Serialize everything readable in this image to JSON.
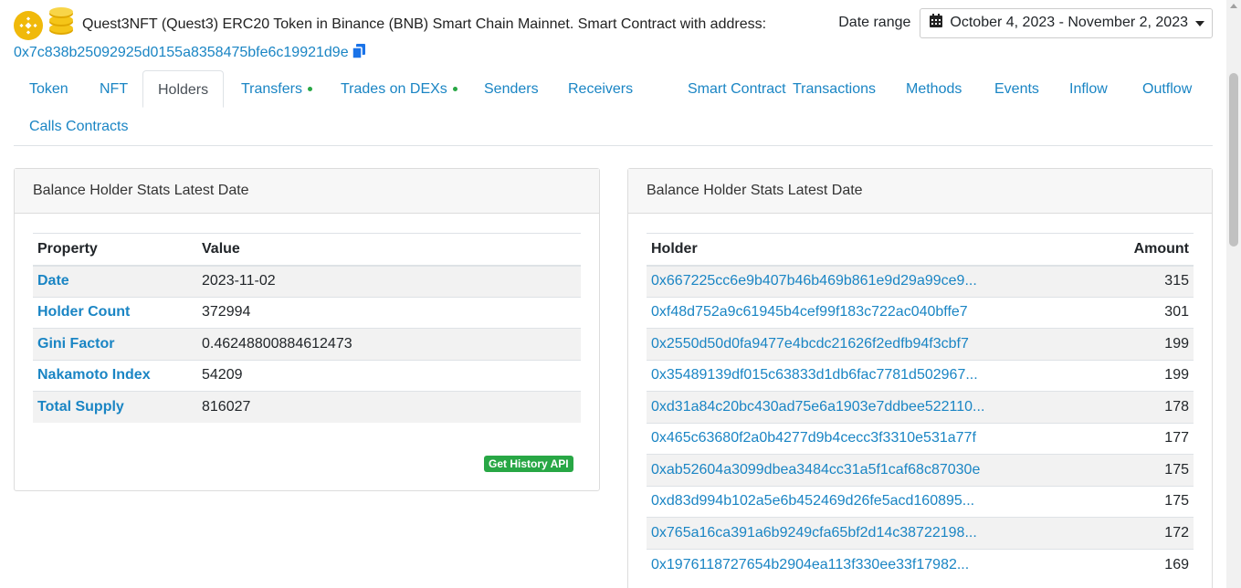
{
  "header": {
    "title": "Quest3NFT (Quest3) ERC20 Token in Binance (BNB) Smart Chain Mainnet. Smart Contract with address:",
    "address": "0x7c838b25092925d0155a8358475bfe6c19921d9e",
    "date_label": "Date range",
    "date_value": "October 4, 2023 - November 2, 2023"
  },
  "tabs": [
    {
      "label": "Token"
    },
    {
      "label": "NFT"
    },
    {
      "label": "Holders"
    },
    {
      "label": "Transfers"
    },
    {
      "label": "Trades on DEXs"
    },
    {
      "label": "Senders"
    },
    {
      "label": "Receivers"
    },
    {
      "label": "Smart Contract"
    },
    {
      "label": "Transactions"
    },
    {
      "label": "Methods"
    },
    {
      "label": "Events"
    },
    {
      "label": "Inflow"
    },
    {
      "label": "Outflow"
    },
    {
      "label": "Calls Contracts"
    }
  ],
  "stats_card": {
    "title": "Balance Holder Stats Latest Date",
    "col_property": "Property",
    "col_value": "Value",
    "rows": [
      {
        "property": "Date",
        "value": "2023-11-02"
      },
      {
        "property": "Holder Count",
        "value": "372994"
      },
      {
        "property": "Gini Factor",
        "value": "0.46248800884612473"
      },
      {
        "property": "Nakamoto Index",
        "value": "54209"
      },
      {
        "property": "Total Supply",
        "value": "816027"
      }
    ],
    "api_button": "Get History API"
  },
  "holders_card": {
    "title": "Balance Holder Stats Latest Date",
    "col_holder": "Holder",
    "col_amount": "Amount",
    "rows": [
      {
        "holder": "0x667225cc6e9b407b46b469b861e9d29a99ce9...",
        "amount": "315"
      },
      {
        "holder": "0xf48d752a9c61945b4cef99f183c722ac040bffe7",
        "amount": "301"
      },
      {
        "holder": "0x2550d50d0fa9477e4bcdc21626f2edfb94f3cbf7",
        "amount": "199"
      },
      {
        "holder": "0x35489139df015c63833d1db6fac7781d502967...",
        "amount": "199"
      },
      {
        "holder": "0xd31a84c20bc430ad75e6a1903e7ddbee522110...",
        "amount": "178"
      },
      {
        "holder": "0x465c63680f2a0b4277d9b4cecc3f3310e531a77f",
        "amount": "177"
      },
      {
        "holder": "0xab52604a3099dbea3484cc31a5f1caf68c87030e",
        "amount": "175"
      },
      {
        "holder": "0xd83d994b102a5e6b452469d26fe5acd160895...",
        "amount": "175"
      },
      {
        "holder": "0x765a16ca391a6b9249cfa65bf2d14c38722198...",
        "amount": "172"
      },
      {
        "holder": "0x1976118727654b2904ea113f330ee33f17982...",
        "amount": "169"
      }
    ]
  },
  "colors": {
    "link": "#1a85c4",
    "badge": "#28a745",
    "bnb": "#f0b90b"
  }
}
